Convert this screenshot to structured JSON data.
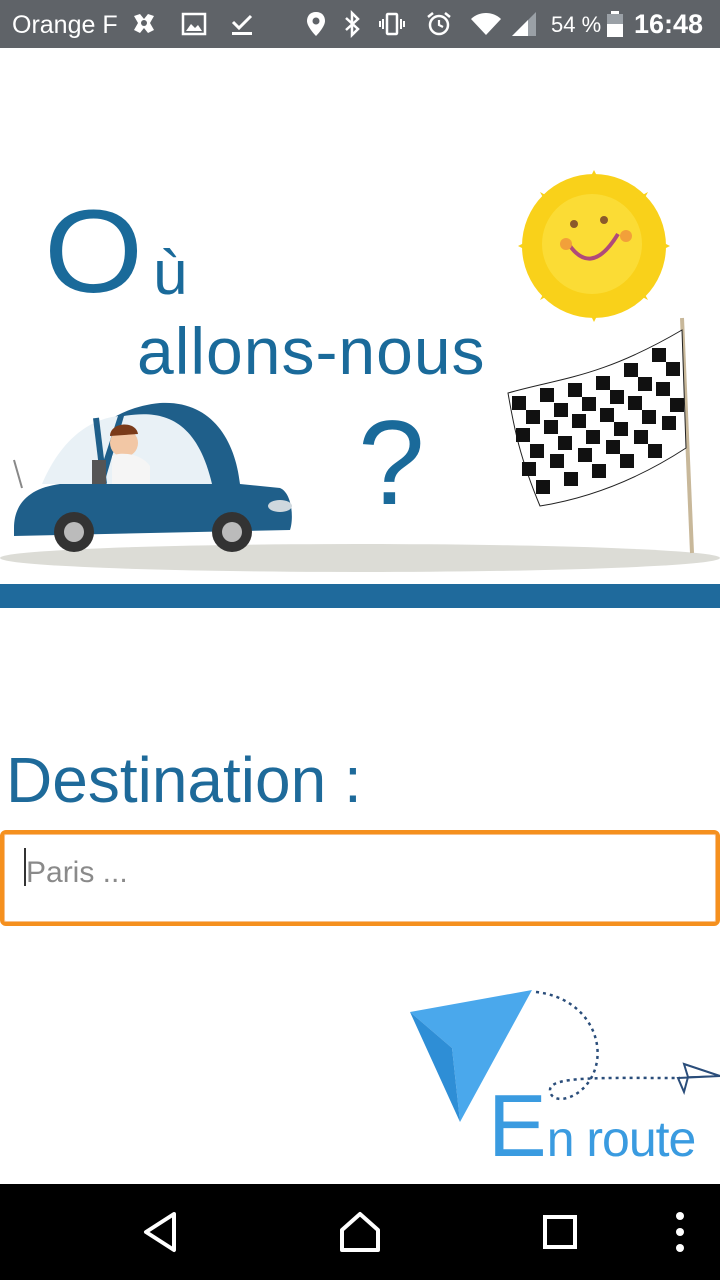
{
  "status_bar": {
    "carrier": "Orange F",
    "battery_percent": "54 %",
    "time": "16:48",
    "icons": [
      "notification-app-icon",
      "image-icon",
      "download-done-icon",
      "location-icon",
      "bluetooth-icon",
      "vibrate-icon",
      "alarm-icon",
      "wifi-icon",
      "signal-icon",
      "battery-icon"
    ]
  },
  "hero": {
    "title_o": "O",
    "title_u": "ù",
    "title_line2": "allons-nous",
    "question_mark": "?"
  },
  "form": {
    "label": "Destination :",
    "input_value": "",
    "input_placeholder": "Paris ..."
  },
  "enroute_button": {
    "label_e": "E",
    "label_rest": "n route"
  },
  "nav_bar": {
    "buttons": [
      "back-icon",
      "home-icon",
      "recents-icon",
      "menu-icon"
    ]
  },
  "colors": {
    "status_bar_bg": "#5f6368",
    "brand_blue": "#1f6a9c",
    "input_border": "#f5901e",
    "enroute_blue": "#3a9be0"
  }
}
